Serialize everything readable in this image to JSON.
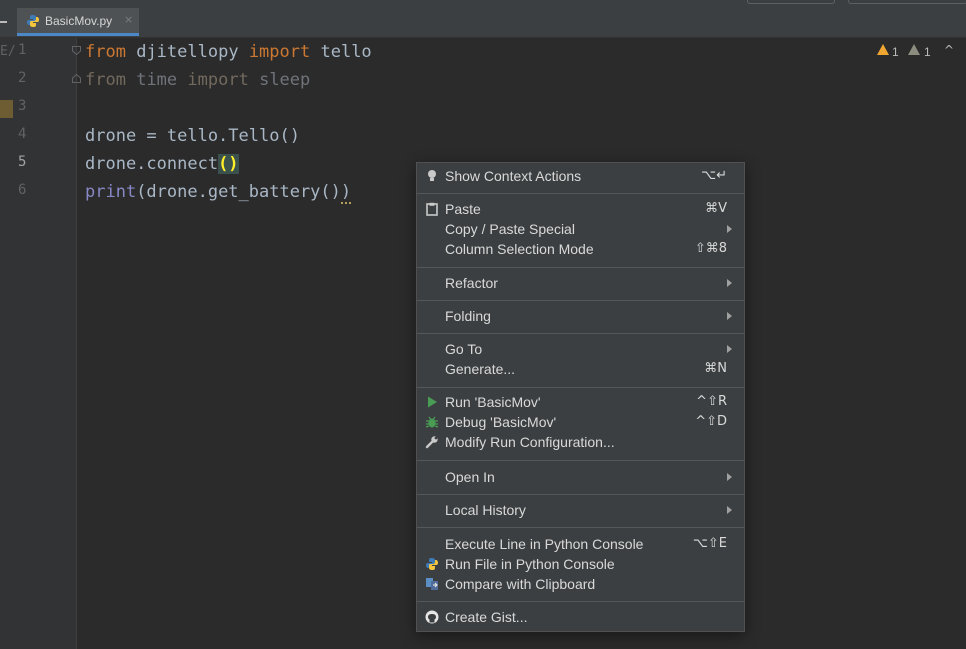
{
  "tab": {
    "label": "BasicMov.py",
    "close": "×"
  },
  "gutter": {
    "cut_label": "E/",
    "lines": [
      "1",
      "2",
      "3",
      "4",
      "5",
      "6"
    ]
  },
  "code": {
    "l1": {
      "kw1": "from",
      "mod": "djitellopy",
      "kw2": "import",
      "name": "tello"
    },
    "l2": {
      "kw1": "from",
      "mod": "time",
      "kw2": "import",
      "name": "sleep"
    },
    "l4": "drone = tello.Tello()",
    "l5": {
      "pre": "drone.connect",
      "braces": "()"
    },
    "l6": {
      "fn": "print",
      "rest": "(drone.get_battery()",
      "close": ")"
    }
  },
  "inspections": {
    "warnings": "1",
    "weak_warnings": "1",
    "toggle": "^"
  },
  "menu": {
    "show_context": {
      "label": "Show Context Actions",
      "shortcut": "⌥↵"
    },
    "paste": {
      "label": "Paste",
      "shortcut": "⌘V"
    },
    "copy_special": {
      "label": "Copy / Paste Special"
    },
    "column_mode": {
      "label": "Column Selection Mode",
      "shortcut": "⇧⌘8"
    },
    "refactor": {
      "label": "Refactor"
    },
    "folding": {
      "label": "Folding"
    },
    "goto": {
      "label": "Go To"
    },
    "generate": {
      "label": "Generate...",
      "shortcut": "⌘N"
    },
    "run": {
      "label": "Run 'BasicMov'",
      "shortcut": "^⇧R"
    },
    "debug": {
      "label": "Debug 'BasicMov'",
      "shortcut": "^⇧D"
    },
    "modify_run": {
      "label": "Modify Run Configuration..."
    },
    "open_in": {
      "label": "Open In"
    },
    "local_history": {
      "label": "Local History"
    },
    "execute_line": {
      "label": "Execute Line in Python Console",
      "shortcut": "⌥⇧E"
    },
    "run_file_console": {
      "label": "Run File in Python Console"
    },
    "compare_clipboard": {
      "label": "Compare with Clipboard"
    },
    "create_gist": {
      "label": "Create Gist..."
    }
  },
  "colors": {
    "accent_tab": "#4a88c7",
    "run_green": "#499c54",
    "warning": "#f0a732"
  }
}
